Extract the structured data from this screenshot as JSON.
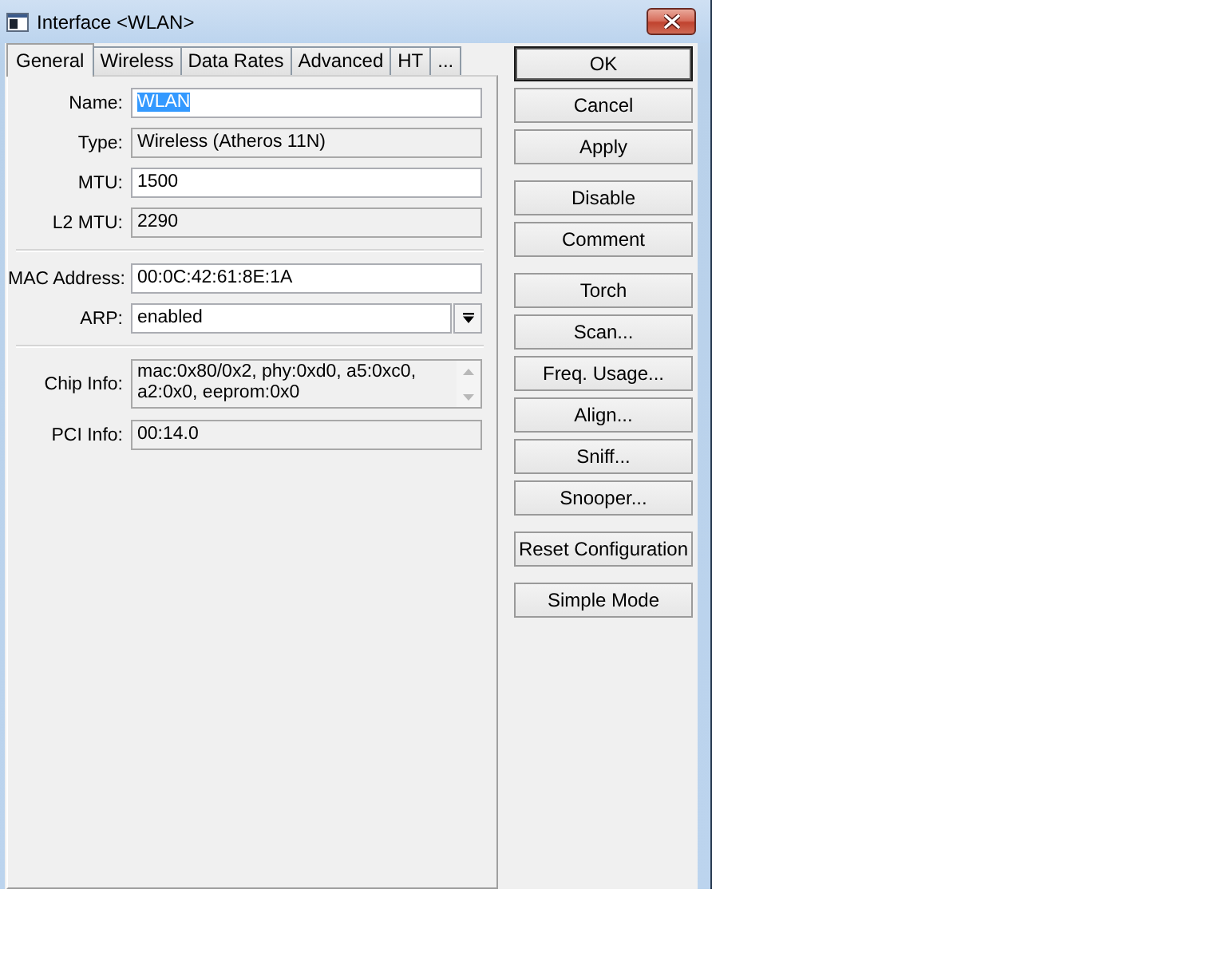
{
  "window": {
    "title": "Interface <WLAN>"
  },
  "tabs": [
    {
      "label": "General",
      "selected": true
    },
    {
      "label": "Wireless",
      "selected": false
    },
    {
      "label": "Data Rates",
      "selected": false
    },
    {
      "label": "Advanced",
      "selected": false
    },
    {
      "label": "HT",
      "selected": false
    },
    {
      "label": "...",
      "selected": false
    }
  ],
  "sections": [
    {
      "fields": [
        {
          "kind": "text",
          "label": "Name:",
          "value": "WLAN",
          "read_only": false,
          "text_selected": true
        },
        {
          "kind": "text",
          "label": "Type:",
          "value": "Wireless (Atheros 11N)",
          "read_only": true,
          "text_selected": false
        },
        {
          "kind": "text",
          "label": "MTU:",
          "value": "1500",
          "read_only": false,
          "text_selected": false
        },
        {
          "kind": "text",
          "label": "L2 MTU:",
          "value": "2290",
          "read_only": true,
          "text_selected": false
        }
      ]
    },
    {
      "fields": [
        {
          "kind": "text",
          "label": "MAC Address:",
          "value": "00:0C:42:61:8E:1A",
          "read_only": false,
          "text_selected": false
        },
        {
          "kind": "dropdown",
          "label": "ARP:",
          "value": "enabled",
          "read_only": false,
          "text_selected": false
        }
      ]
    },
    {
      "fields": [
        {
          "kind": "multiline",
          "label": "Chip Info:",
          "value": "mac:0x80/0x2, phy:0xd0, a5:0xc0, a2:0x0, eeprom:0x0",
          "read_only": true,
          "text_selected": false
        },
        {
          "kind": "text",
          "label": "PCI Info:",
          "value": "00:14.0",
          "read_only": true,
          "text_selected": false
        }
      ]
    }
  ],
  "button_groups": [
    [
      {
        "label": "OK",
        "default": true
      },
      {
        "label": "Cancel",
        "default": false
      },
      {
        "label": "Apply",
        "default": false
      }
    ],
    [
      {
        "label": "Disable",
        "default": false
      },
      {
        "label": "Comment",
        "default": false
      }
    ],
    [
      {
        "label": "Torch",
        "default": false
      },
      {
        "label": "Scan...",
        "default": false
      },
      {
        "label": "Freq. Usage...",
        "default": false
      },
      {
        "label": "Align...",
        "default": false
      },
      {
        "label": "Sniff...",
        "default": false
      },
      {
        "label": "Snooper...",
        "default": false
      }
    ],
    [
      {
        "label": "Reset Configuration",
        "default": false
      }
    ],
    [
      {
        "label": "Simple Mode",
        "default": false
      }
    ]
  ]
}
